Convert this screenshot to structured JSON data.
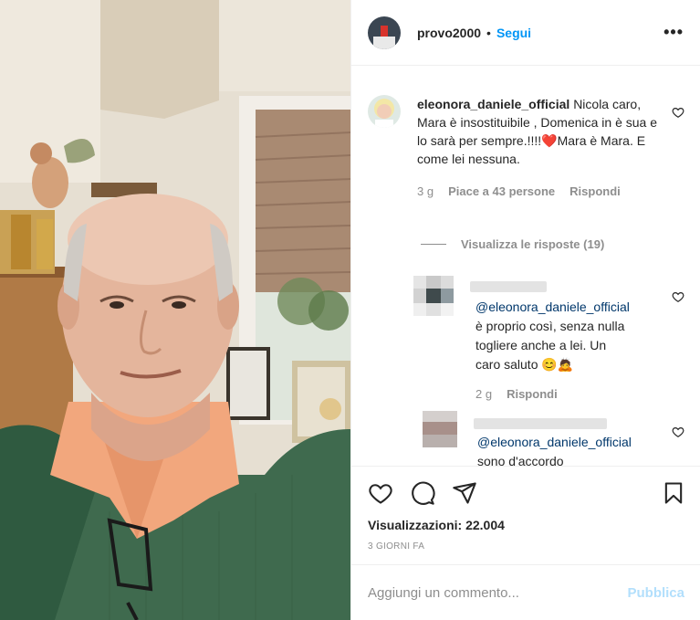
{
  "post": {
    "author": "provo2000",
    "separator": "•",
    "follow_label": "Segui",
    "more_label": "•••"
  },
  "comment": {
    "username": "eleonora_daniele_official",
    "text": "Nicola caro, Mara è insostituibile , Domenica in è sua e lo sarà per sempre.!!!!❤️Mara è Mara. E come lei nessuna.",
    "time": "3 g",
    "likes": "Piace a 43 persone",
    "reply_label": "Rispondi",
    "view_replies": "Visualizza le risposte (19)"
  },
  "replies": [
    {
      "mention": "@eleonora_daniele_official",
      "lines": [
        "è proprio così, senza nulla",
        "togliere anche a lei. Un",
        "caro saluto 😊🙇"
      ],
      "time": "2 g",
      "reply_label": "Rispondi"
    },
    {
      "mention": "@eleonora_daniele_official",
      "lines": [
        "sono d'accordo"
      ]
    }
  ],
  "footer": {
    "views_label": "Visualizzazioni: 22.004",
    "date_label": "3 GIORNI FA",
    "comment_placeholder": "Aggiungi un commento...",
    "publish_label": "Pubblica"
  },
  "icons": {
    "like": "heart-icon",
    "comment": "comment-icon",
    "share": "share-icon",
    "save": "bookmark-icon",
    "comment_like": "heart-icon"
  },
  "colors": {
    "link_blue": "#0095f6",
    "mention": "#00376b",
    "muted": "#8e8e8e",
    "publish_disabled": "#b2dffc"
  }
}
